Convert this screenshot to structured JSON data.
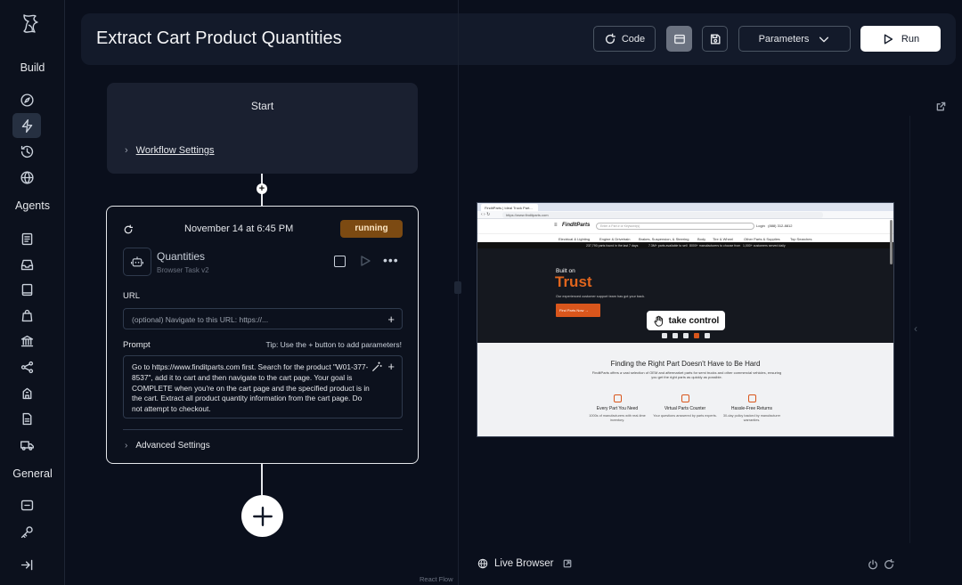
{
  "app": {
    "sidebar": {
      "headings": {
        "build": "Build",
        "agents": "Agents",
        "general": "General"
      },
      "build_items": [
        "compass-icon",
        "bolt-icon",
        "history-icon",
        "globe-icon"
      ],
      "agent_items": [
        "document-icon",
        "inbox-icon",
        "book-icon",
        "bag-icon",
        "bank-icon",
        "share-icon",
        "building-icon",
        "file-icon",
        "truck-icon"
      ],
      "general_items": [
        "message-icon",
        "key-icon"
      ],
      "collapse_icon": "collapse-icon"
    }
  },
  "header": {
    "title": "Extract Cart Product Quantities",
    "code_label": "Code",
    "parameters_label": "Parameters",
    "run_label": "Run"
  },
  "workflow": {
    "start": {
      "title": "Start",
      "settings_label": "Workflow Settings"
    },
    "task": {
      "date": "November 14 at 6:45 PM",
      "status": "running",
      "name": "Quantities",
      "type": "Browser Task v2",
      "url_label": "URL",
      "url_placeholder": "(optional) Navigate to this URL: https://...",
      "prompt_label": "Prompt",
      "prompt_tip": "Tip: Use the + button to add parameters!",
      "prompt_text": "Go to https://www.finditparts.com first. Search for the product \"W01-377-8537\", add it to cart and then navigate to the cart page. Your goal is COMPLETE when you're on the cart page and the specified product is in the cart. Extract all product quantity information from the cart page. Do not attempt to checkout.",
      "advanced_label": "Advanced Settings"
    },
    "footer_label": "React Flow"
  },
  "browser": {
    "tab_title": "FinditParts | Ideal Truck Part...",
    "address": "https://www.finditparts.com",
    "site": {
      "logo": "FindItParts",
      "search_placeholder": "Enter a Part # or Keyword(s)",
      "login": "Login",
      "phone": "(888) 312-8812",
      "nav": [
        "Electrical & Lighting",
        "Engine & Drivetrain",
        "Brakes, Suspension, & Steering",
        "Body",
        "Tire & Wheel",
        "Other Parts & Supplies",
        "Top Searches"
      ],
      "strip": [
        "237,790 parts found in the last 7 days",
        "7.3M+ parts available to sell",
        "8000+ manufacturers to choose from",
        "1,000+ customers served daily"
      ],
      "hero_small": "Built on",
      "hero_big": "Trust",
      "hero_sub": "Our experienced customer support team has got your back.",
      "hero_cta": "Find Parts Now →",
      "take_control": "take control",
      "section_title": "Finding the Right Part Doesn't Have to Be Hard",
      "section_desc": "FinditParts offers a vast selection of OEM and aftermarket parts for semi trucks and other commercial vehicles, ensuring you get the right parts as quickly as possible.",
      "features": [
        {
          "title": "Every Part You Need",
          "desc": "1000s of manufacturers with real-time inventory."
        },
        {
          "title": "Virtual Parts Counter",
          "desc": "Your questions answered by parts experts."
        },
        {
          "title": "Hassle-Free Returns",
          "desc": "30-day policy backed by manufacturer warranties."
        }
      ]
    },
    "live_label": "Live Browser"
  },
  "colors": {
    "accent_orange": "#d9561c",
    "badge_running": "#7c4a12",
    "background": "#0a0f1c"
  }
}
